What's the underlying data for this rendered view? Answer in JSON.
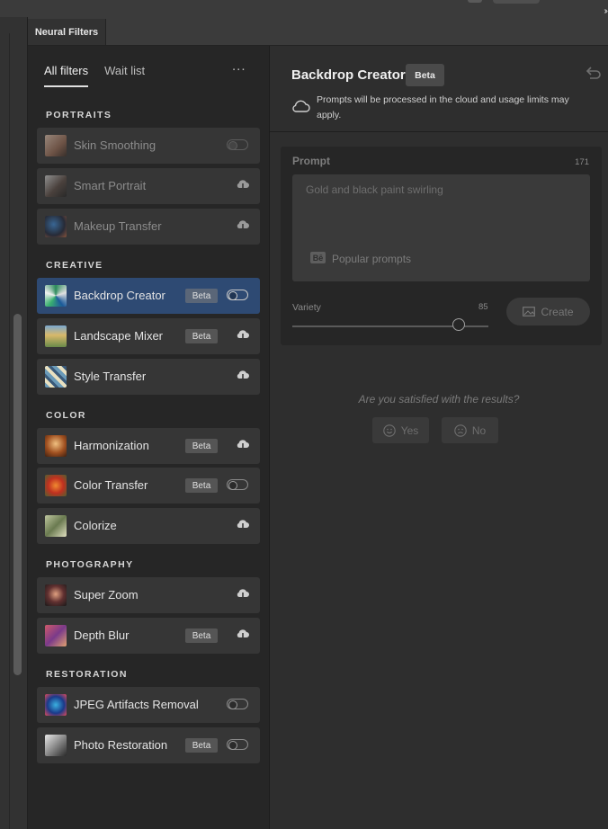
{
  "panel_tab": "Neural Filters",
  "filter_tabs": {
    "all": "All filters",
    "waitlist": "Wait list",
    "more": "..."
  },
  "sections": [
    {
      "title": "PORTRAITS",
      "items": [
        {
          "label": "Skin Smoothing",
          "beta": false,
          "control": "toggle",
          "enabled": false,
          "selected": false
        },
        {
          "label": "Smart Portrait",
          "beta": false,
          "control": "download",
          "enabled": false,
          "selected": false
        },
        {
          "label": "Makeup Transfer",
          "beta": false,
          "control": "download",
          "enabled": false,
          "selected": false
        }
      ]
    },
    {
      "title": "CREATIVE",
      "items": [
        {
          "label": "Backdrop Creator",
          "beta": true,
          "control": "toggle",
          "enabled": true,
          "selected": true
        },
        {
          "label": "Landscape Mixer",
          "beta": true,
          "control": "download",
          "enabled": true,
          "selected": false
        },
        {
          "label": "Style Transfer",
          "beta": false,
          "control": "download",
          "enabled": true,
          "selected": false
        }
      ]
    },
    {
      "title": "COLOR",
      "items": [
        {
          "label": "Harmonization",
          "beta": true,
          "control": "download",
          "enabled": true,
          "selected": false
        },
        {
          "label": "Color Transfer",
          "beta": true,
          "control": "toggle",
          "enabled": true,
          "selected": false
        },
        {
          "label": "Colorize",
          "beta": false,
          "control": "download",
          "enabled": true,
          "selected": false
        }
      ]
    },
    {
      "title": "PHOTOGRAPHY",
      "items": [
        {
          "label": "Super Zoom",
          "beta": false,
          "control": "download",
          "enabled": true,
          "selected": false
        },
        {
          "label": "Depth Blur",
          "beta": true,
          "control": "download",
          "enabled": true,
          "selected": false
        }
      ]
    },
    {
      "title": "RESTORATION",
      "items": [
        {
          "label": "JPEG Artifacts Removal",
          "beta": false,
          "control": "toggle",
          "enabled": true,
          "selected": false
        },
        {
          "label": "Photo Restoration",
          "beta": true,
          "control": "toggle",
          "enabled": true,
          "selected": false
        }
      ]
    }
  ],
  "beta_label": "Beta",
  "detail": {
    "title": "Backdrop Creator",
    "badge": "Beta",
    "note": "Prompts will be processed in the cloud and usage limits may apply.",
    "prompt": {
      "label": "Prompt",
      "char_count": "171",
      "placeholder": "Gold and black paint swirling",
      "behance_glyph": "Bē",
      "popular_label": "Popular prompts"
    },
    "variety": {
      "label": "Variety",
      "value": "85",
      "level": 0.85
    },
    "create_label": "Create",
    "feedback": {
      "question": "Are you satisfied with the results?",
      "yes": "Yes",
      "no": "No"
    }
  },
  "colors": {
    "selected_row": "#2e4a73",
    "panel_bg": "#262626",
    "row_bg": "#363636"
  }
}
